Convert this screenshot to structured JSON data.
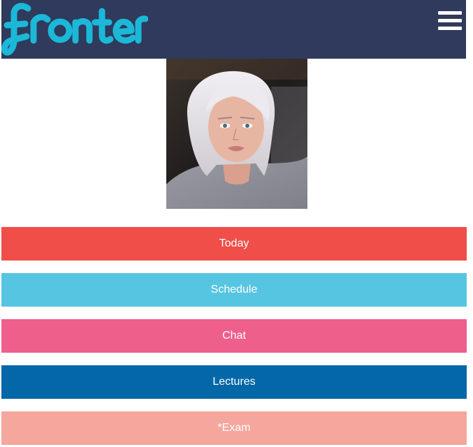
{
  "app": {
    "logo_text": "fronter"
  },
  "header": {
    "menu_icon": "hamburger-menu-icon",
    "background_color": "#2f3a5c",
    "logo_color": "#1bb8d8"
  },
  "profile": {
    "avatar_description": "user profile photo"
  },
  "nav": {
    "items": [
      {
        "label": "Today",
        "color": "#ef4f48"
      },
      {
        "label": "Schedule",
        "color": "#56c5e1"
      },
      {
        "label": "Chat",
        "color": "#ef5f8b"
      },
      {
        "label": "Lectures",
        "color": "#0467a7"
      },
      {
        "label": "*Exam",
        "color": "#f5a79e"
      }
    ]
  }
}
